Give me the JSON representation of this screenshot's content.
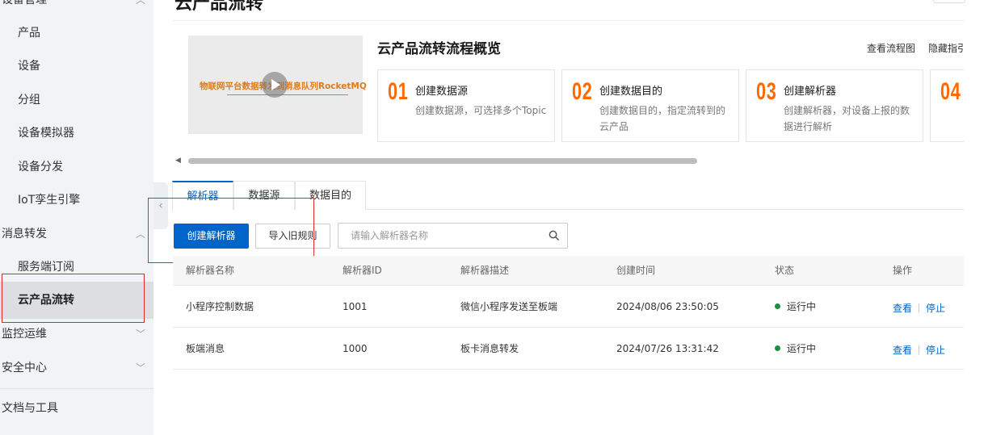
{
  "sidebar": {
    "items": [
      {
        "label": "设备管理",
        "kind": "group"
      },
      {
        "label": "产品",
        "kind": "sub"
      },
      {
        "label": "设备",
        "kind": "sub"
      },
      {
        "label": "分组",
        "kind": "sub"
      },
      {
        "label": "设备模拟器",
        "kind": "sub"
      },
      {
        "label": "设备分发",
        "kind": "sub"
      },
      {
        "label": "IoT孪生引擎",
        "kind": "sub"
      },
      {
        "label": "消息转发",
        "kind": "group"
      },
      {
        "label": "服务端订阅",
        "kind": "sub"
      },
      {
        "label": "云产品流转",
        "kind": "sub",
        "active": true
      },
      {
        "label": "监控运维",
        "kind": "group"
      },
      {
        "label": "安全中心",
        "kind": "group"
      },
      {
        "label": "文档与工具",
        "kind": "group"
      }
    ]
  },
  "header": {
    "title": "云产品流转"
  },
  "overview": {
    "video_caption": "物联网平台数据转发到消息队列RocketMQ",
    "title": "云产品流转流程概览",
    "view_flow_link": "查看流程图",
    "hide_guide_link": "隐藏指引",
    "steps": [
      {
        "num": "01",
        "title": "创建数据源",
        "desc": "创建数据源，可选择多个Topic"
      },
      {
        "num": "02",
        "title": "创建数据目的",
        "desc": "创建数据目的，指定流转到的云产品"
      },
      {
        "num": "03",
        "title": "创建解析器",
        "desc": "创建解析器，对设备上报的数据进行解析"
      },
      {
        "num": "04",
        "title": "",
        "desc": ""
      }
    ]
  },
  "tabs": [
    {
      "label": "解析器",
      "active": true
    },
    {
      "label": "数据源",
      "active": false
    },
    {
      "label": "数据目的",
      "active": false
    }
  ],
  "toolbar": {
    "create_label": "创建解析器",
    "import_label": "导入旧规则",
    "search_placeholder": "请输入解析器名称"
  },
  "table": {
    "columns": [
      "解析器名称",
      "解析器ID",
      "解析器描述",
      "创建时间",
      "状态",
      "操作"
    ],
    "rows": [
      {
        "name": "小程序控制数据",
        "id": "1001",
        "desc": "微信小程序发送至板端",
        "created": "2024/08/06 23:50:05",
        "status": "运行中",
        "op_view": "查看",
        "op_stop": "停止"
      },
      {
        "name": "板端消息",
        "id": "1000",
        "desc": "板卡消息转发",
        "created": "2024/07/26 13:31:42",
        "status": "运行中",
        "op_view": "查看",
        "op_stop": "停止"
      }
    ]
  },
  "colors": {
    "primary": "#0064c8",
    "accent_orange": "#ff6a00",
    "status_running": "#1e8e3e",
    "annotation_red": "#e0282e"
  },
  "icons": [
    "play-icon",
    "search-icon",
    "chevron-up-icon",
    "chevron-down-icon",
    "chevron-left-icon",
    "scroll-left-icon"
  ]
}
